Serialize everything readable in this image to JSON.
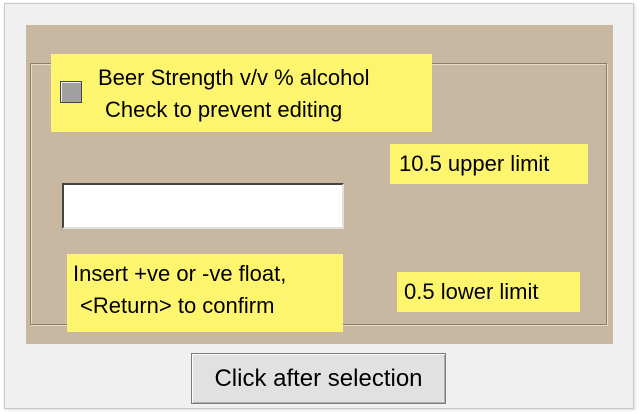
{
  "colors": {
    "window_bg": "#f0f0f0",
    "frame_bg": "#c8b7a1",
    "label_bg": "#fef56e",
    "checkbox_fill": "#a0a0a0"
  },
  "checkbox": {
    "checked": false,
    "label_line1": "Beer Strength v/v % alcohol",
    "label_line2": "Check to prevent editing"
  },
  "limits": {
    "upper_label": "10.5  upper limit",
    "lower_label": "0.5  lower limit"
  },
  "input": {
    "value": "",
    "hint_line1": "Insert +ve or -ve float,",
    "hint_line2": "<Return> to confirm"
  },
  "button": {
    "label": "Click after selection"
  }
}
